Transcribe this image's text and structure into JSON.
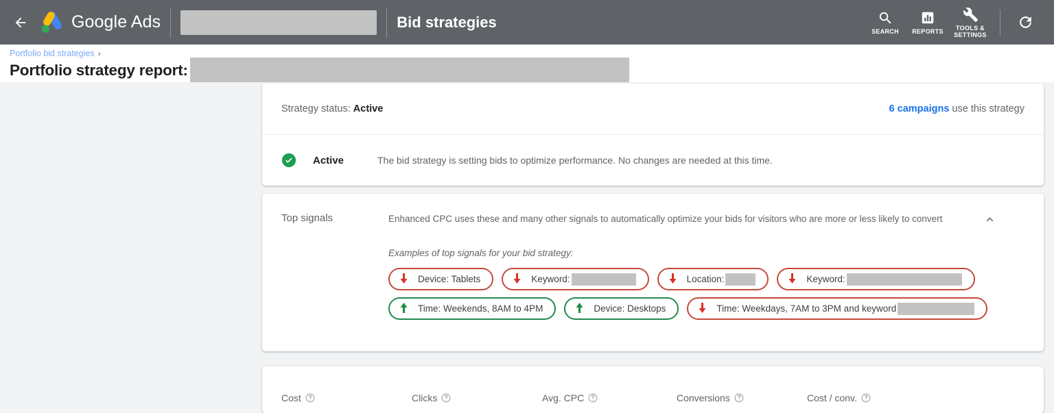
{
  "appbar": {
    "back_label": "Back",
    "brand": "Google Ads",
    "account_redacted": "",
    "page_label": "Bid strategies",
    "tools": [
      {
        "icon": "search-icon",
        "label": "SEARCH"
      },
      {
        "icon": "reports-bar-chart-icon",
        "label": "REPORTS"
      },
      {
        "icon": "wrench-icon",
        "label": "TOOLS &\nSETTINGS"
      }
    ],
    "refresh_label": "Refresh"
  },
  "breadcrumb": {
    "link": "Portfolio bid strategies",
    "separator": "›",
    "title": "Portfolio strategy report:",
    "title_redacted": ""
  },
  "status_card": {
    "status_prefix": "Strategy status:",
    "status_value": "Active",
    "campaigns_link": "6 campaigns",
    "campaigns_suffix": "use this strategy",
    "state_icon": "check-circle-icon",
    "state_label": "Active",
    "state_description": "The bid strategy is setting bids to optimize performance. No changes are needed at this time."
  },
  "signals_card": {
    "title": "Top signals",
    "description": "Enhanced CPC uses these and many other signals to automatically optimize your bids for visitors who are more or less likely to convert",
    "collapse_icon": "chevron-up-icon",
    "examples_label": "Examples of top signals for your bid strategy:",
    "chip_rows": [
      [
        {
          "direction": "down",
          "text": "Device: Tablets",
          "redact_width": 0
        },
        {
          "direction": "down",
          "text": "Keyword:",
          "redact_width": 94
        },
        {
          "direction": "down",
          "text": "Location:",
          "redact_width": 44
        },
        {
          "direction": "down",
          "text": "Keyword:",
          "redact_width": 168
        }
      ],
      [
        {
          "direction": "up",
          "text": "Time: Weekends, 8AM to 4PM",
          "redact_width": 0
        },
        {
          "direction": "up",
          "text": "Device: Desktops",
          "redact_width": 0
        },
        {
          "direction": "down",
          "text": "Time: Weekdays, 7AM to 3PM and keyword",
          "redact_width": 112
        }
      ]
    ]
  },
  "metrics_card": {
    "columns": [
      {
        "label": "Cost",
        "help": "help-icon",
        "width": 190
      },
      {
        "label": "Clicks",
        "help": "help-icon",
        "width": 190
      },
      {
        "label": "Avg. CPC",
        "help": "help-icon",
        "width": 196
      },
      {
        "label": "Conversions",
        "help": "help-icon",
        "width": 190
      },
      {
        "label": "Cost / conv.",
        "help": "help-icon",
        "width": 190
      }
    ]
  },
  "colors": {
    "appbar_bg": "#5f6368",
    "page_bg": "#f1f3f4",
    "card_bg": "#ffffff",
    "link_blue": "#1a73e8",
    "crumb_blue": "#7baaf7",
    "success_green": "#1f8a4c",
    "signal_down_red": "#c5493b",
    "redact_gray": "#c2c2c2",
    "text_primary": "#202124",
    "text_secondary": "#5f6368"
  }
}
